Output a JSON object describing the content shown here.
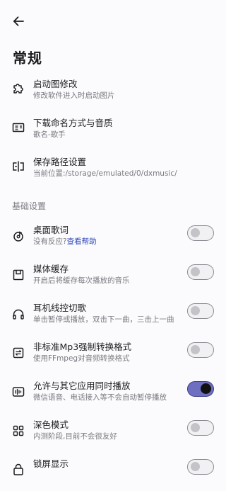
{
  "header": {
    "back_icon": "arrow-left-icon",
    "title": "常规"
  },
  "general_items": [
    {
      "title": "启动图修改",
      "subtitle": "修改软件进入时启动图片",
      "icon": "puzzle-icon"
    },
    {
      "title": "下载命名方式与音质",
      "subtitle": "歌名-歌手",
      "icon": "id-card-icon"
    },
    {
      "title": "保存路径设置",
      "subtitle": "当前位置:/storage/emulated/0/dxmusic/",
      "icon": "path-split-icon"
    }
  ],
  "basic_settings": {
    "section_label": "基础设置",
    "items": [
      {
        "title": "桌面歌词",
        "subtitle": "没有反应?",
        "link": "查看帮助",
        "icon": "lyrics-icon",
        "enabled": false
      },
      {
        "title": "媒体缓存",
        "subtitle": "开启后将缓存每次播放的音乐",
        "icon": "cache-box-icon",
        "enabled": false
      },
      {
        "title": "耳机线控切歌",
        "subtitle": "单击暂停或播放，双击下一曲，三击上一曲",
        "icon": "headphones-icon",
        "enabled": false
      },
      {
        "title": "非标准Mp3强制转换格式",
        "subtitle": "使用FFmpeg对音频转换格式",
        "icon": "convert-icon",
        "enabled": false
      },
      {
        "title": "允许与其它应用同时播放",
        "subtitle": "微信语音、电话接入等不会自动暂停播放",
        "icon": "audio-wave-icon",
        "enabled": true
      },
      {
        "title": "深色模式",
        "subtitle": "内测阶段,目前不会很友好",
        "icon": "grid-icon",
        "enabled": false
      },
      {
        "title": "锁屏显示",
        "icon": "lock-screen-icon",
        "enabled": false
      }
    ]
  },
  "colors": {
    "accent": "#6e6fc1",
    "link": "#2d47b8",
    "background": "#fbfbfd"
  }
}
